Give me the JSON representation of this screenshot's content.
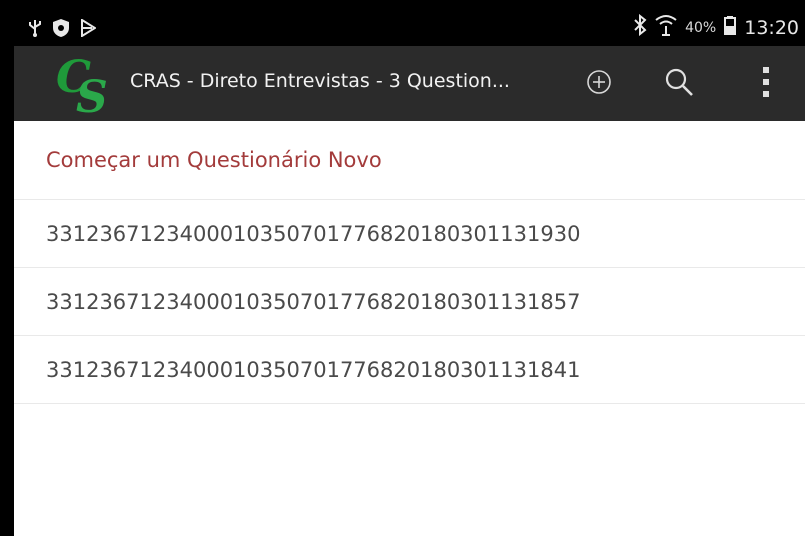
{
  "status_bar": {
    "battery_percent": "40%",
    "time": "13:20",
    "icons": [
      "usb-icon",
      "shield-icon",
      "play-store-icon",
      "bluetooth-icon",
      "wifi-icon",
      "battery-icon"
    ]
  },
  "action_bar": {
    "logo_text": "CS",
    "title": "CRAS - Direto Entrevistas - 3 Question...",
    "actions": [
      "add-icon",
      "search-icon",
      "overflow-menu-icon"
    ],
    "colors": {
      "background": "#2b2b2b",
      "logo_green": "#1f9a3a"
    }
  },
  "list": {
    "new_questionnaire_label": "Começar um Questionário Novo",
    "items": [
      "331236712340001035070177682018030113193​0",
      "3312367123400010350701776820180301131857",
      "3312367123400010350701776820180301131841"
    ],
    "colors": {
      "header_text": "#a33b3b",
      "item_text": "#4a4a4a"
    }
  }
}
